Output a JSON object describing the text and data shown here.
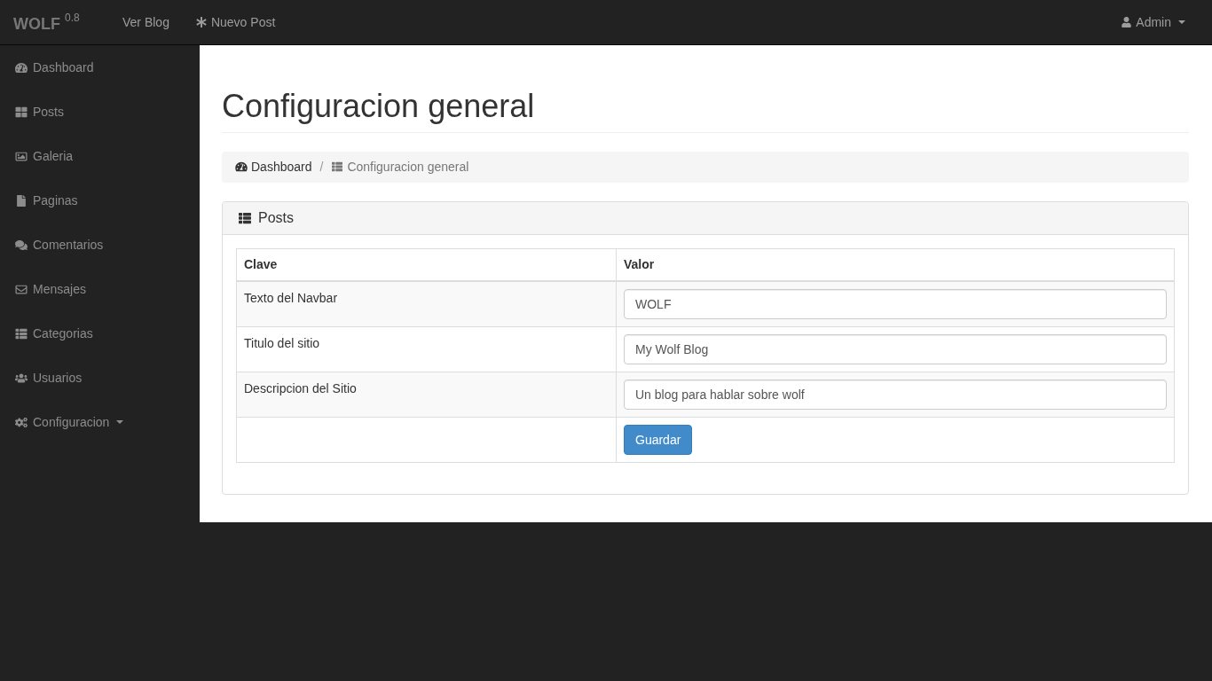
{
  "navbar": {
    "brand": "WOLF",
    "version": "0.8",
    "links": [
      {
        "label": "Ver Blog"
      },
      {
        "label": "Nuevo Post"
      }
    ],
    "user_menu": {
      "label": "Admin"
    }
  },
  "sidebar": {
    "items": [
      {
        "label": "Dashboard",
        "has_submenu": false
      },
      {
        "label": "Posts",
        "has_submenu": false
      },
      {
        "label": "Galeria",
        "has_submenu": false
      },
      {
        "label": "Paginas",
        "has_submenu": false
      },
      {
        "label": "Comentarios",
        "has_submenu": false
      },
      {
        "label": "Mensajes",
        "has_submenu": false
      },
      {
        "label": "Categorias",
        "has_submenu": false
      },
      {
        "label": "Usuarios",
        "has_submenu": false
      },
      {
        "label": "Configuracion",
        "has_submenu": true
      }
    ]
  },
  "page": {
    "title": "Configuracion general"
  },
  "breadcrumb": {
    "separator": "/",
    "items": [
      {
        "label": "Dashboard",
        "current": false
      },
      {
        "label": "Configuracion general",
        "current": true
      }
    ]
  },
  "panel": {
    "title": "Posts",
    "table": {
      "columns": [
        "Clave",
        "Valor"
      ],
      "rows": [
        {
          "key": "Texto del Navbar",
          "value": "WOLF"
        },
        {
          "key": "Titulo del sitio",
          "value": "My Wolf Blog"
        },
        {
          "key": "Descripcion del Sitio",
          "value": "Un blog para hablar sobre wolf"
        }
      ],
      "submit_button": {
        "label": "Guardar"
      }
    }
  }
}
